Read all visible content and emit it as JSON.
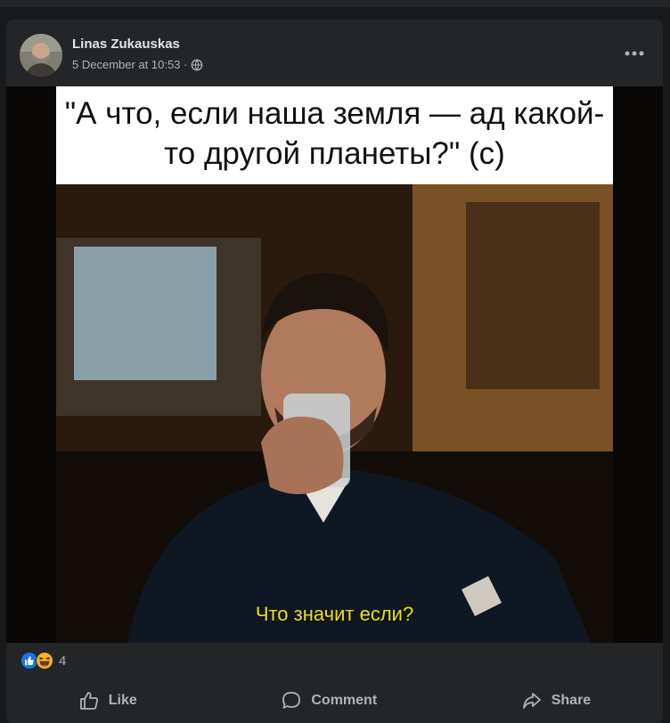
{
  "post": {
    "author": "Linas Zukauskas",
    "timestamp": "5 December at 10:53 · ",
    "audience_icon": "globe-icon",
    "more_icon": "more-options-icon",
    "image": {
      "top_text": "\"А что, если наша земля — ад какой-то другой планеты?\" (с)",
      "subtitle": "Что значит если?"
    },
    "reactions": {
      "icons": [
        "like-reaction-icon",
        "haha-reaction-icon"
      ],
      "count": "4"
    },
    "actions": {
      "like": "Like",
      "comment": "Comment",
      "share": "Share"
    }
  }
}
